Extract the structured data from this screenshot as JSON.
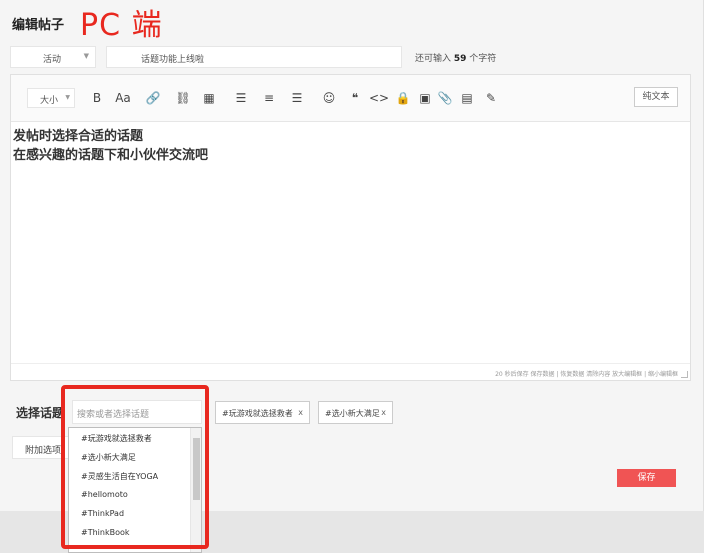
{
  "header": {
    "title": "编辑帖子",
    "overlay_label": "PC 端"
  },
  "post_form": {
    "type_select": {
      "value": "活动"
    },
    "title_input": {
      "value": "话题功能上线啦"
    },
    "char_hint": {
      "prefix": "还可输入",
      "count": "59",
      "suffix": "个字符"
    }
  },
  "toolbar": {
    "font_size_label": "大小",
    "buttons": [
      {
        "name": "bold-icon",
        "glyph": "B"
      },
      {
        "name": "font-icon",
        "glyph": "Aa"
      },
      {
        "name": "link-icon",
        "glyph": "🔗"
      },
      {
        "name": "unlink-icon",
        "glyph": "⛓"
      },
      {
        "name": "table-icon",
        "glyph": "▦"
      },
      {
        "name": "align-left-icon",
        "glyph": "☰"
      },
      {
        "name": "align-center-icon",
        "glyph": "≡"
      },
      {
        "name": "align-right-icon",
        "glyph": "☰"
      },
      {
        "name": "emoji-icon",
        "glyph": "☺"
      },
      {
        "name": "quote-icon",
        "glyph": "❝"
      },
      {
        "name": "code-icon",
        "glyph": "<>"
      },
      {
        "name": "lock-icon",
        "glyph": "🔒"
      },
      {
        "name": "image-icon",
        "glyph": "▣"
      },
      {
        "name": "attachment-icon",
        "glyph": "📎"
      },
      {
        "name": "video-icon",
        "glyph": "▤"
      },
      {
        "name": "brush-icon",
        "glyph": "✎"
      }
    ],
    "plain_text_label": "纯文本"
  },
  "editor": {
    "content_lines": [
      "发帖时选择合适的话题",
      "在感兴趣的话题下和小伙伴交流吧"
    ],
    "status_text": "20 秒后保存 保存数据 | 恢复数据   清除内容   放大编辑框 | 缩小编辑框"
  },
  "topic": {
    "label": "选择话题",
    "search_placeholder": "搜索或者选择话题",
    "selected": [
      {
        "label": "#玩游戏就选拯救者",
        "remove": "x"
      },
      {
        "label": "#选小新大满足",
        "remove": "x"
      }
    ],
    "options": [
      "#玩游戏就选拯救者",
      "#选小新大满足",
      "#灵感生活自在YOGA",
      "#hellomoto",
      "#ThinkPad",
      "#ThinkBook"
    ]
  },
  "attach_label": "附加选项",
  "save_label": "保存",
  "colors": {
    "accent": "#e8281f",
    "save_button": "#f05454"
  }
}
